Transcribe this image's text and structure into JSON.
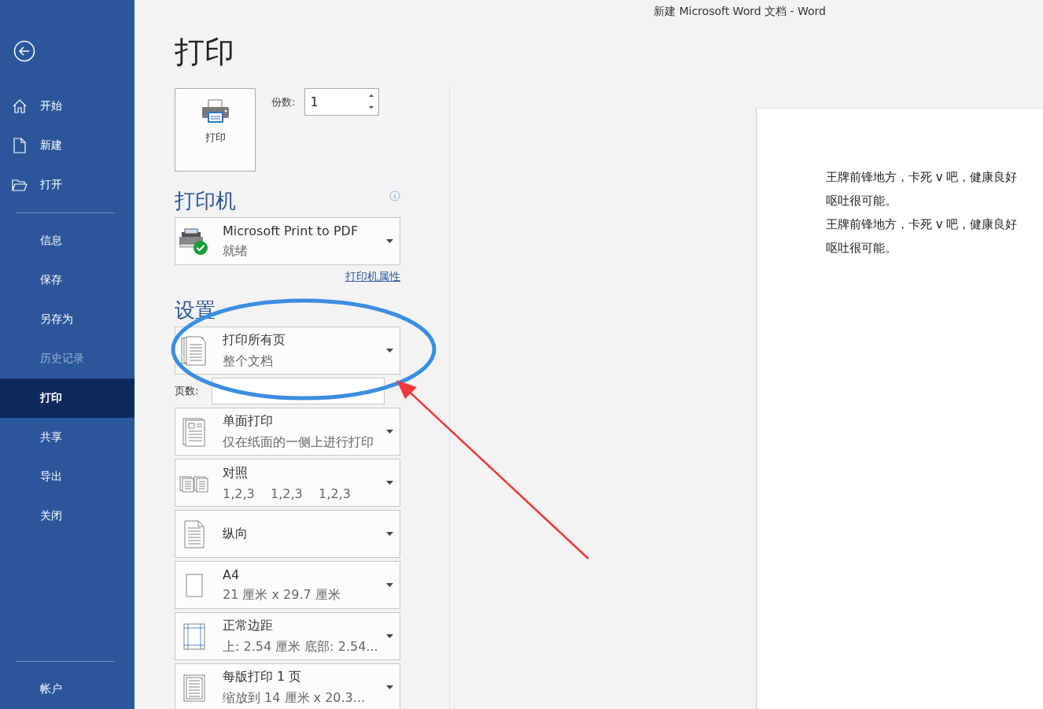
{
  "window": {
    "title": "新建 Microsoft Word 文档  -  Word"
  },
  "sidebar": {
    "primary_items": [
      {
        "label": "开始",
        "kind": "home",
        "selected": false,
        "disabled": false
      },
      {
        "label": "新建",
        "kind": "new",
        "selected": false,
        "disabled": false
      },
      {
        "label": "打开",
        "kind": "open",
        "selected": false,
        "disabled": false
      }
    ],
    "secondary_items": [
      {
        "label": "信息",
        "selected": false,
        "disabled": false
      },
      {
        "label": "保存",
        "selected": false,
        "disabled": false
      },
      {
        "label": "另存为",
        "selected": false,
        "disabled": false
      },
      {
        "label": "历史记录",
        "selected": false,
        "disabled": true
      },
      {
        "label": "打印",
        "selected": true,
        "disabled": false
      },
      {
        "label": "共享",
        "selected": false,
        "disabled": false
      },
      {
        "label": "导出",
        "selected": false,
        "disabled": false
      },
      {
        "label": "关闭",
        "selected": false,
        "disabled": false
      }
    ],
    "footer_item": {
      "label": "帐户",
      "selected": false
    }
  },
  "print": {
    "title": "打印",
    "print_button": "打印",
    "copies": {
      "label": "份数:",
      "value": "1"
    },
    "printer": {
      "heading": "打印机",
      "name": "Microsoft Print to PDF",
      "status": "就绪",
      "properties_link": "打印机属性"
    },
    "settings": {
      "heading": "设置",
      "pages": {
        "label": "页数:"
      },
      "options": [
        {
          "kind": "pages",
          "title": "打印所有页",
          "subtitle": "整个文档"
        },
        {
          "kind": "sides",
          "title": "单面打印",
          "subtitle": "仅在纸面的一侧上进行打印"
        },
        {
          "kind": "collate",
          "title": "对照",
          "subtitle": "1,2,3    1,2,3    1,2,3"
        },
        {
          "kind": "orientation",
          "title": "纵向"
        },
        {
          "kind": "paper",
          "title": "A4",
          "subtitle": "21 厘米 x 29.7 厘米"
        },
        {
          "kind": "margins",
          "title": "正常边距",
          "subtitle": "上: 2.54 厘米 底部: 2.54..."
        },
        {
          "kind": "persheet",
          "title": "每版打印 1 页",
          "subtitle": "缩放到 14 厘米 x 20.3..."
        }
      ]
    }
  },
  "preview": {
    "lines": [
      "王牌前锋地方，卡死 v 吧，健康良好",
      "呕吐很可能。",
      "王牌前锋地方，卡死 v 吧，健康良好",
      "呕吐很可能。"
    ]
  }
}
